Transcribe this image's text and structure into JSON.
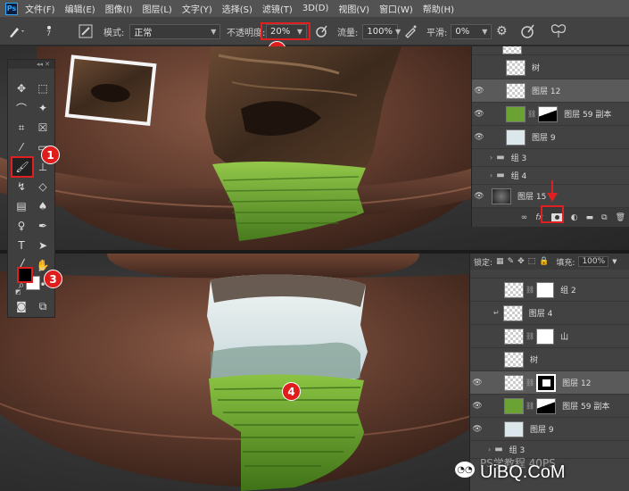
{
  "menu": {
    "logo": "Ps",
    "items": [
      "文件(F)",
      "编辑(E)",
      "图像(I)",
      "图层(L)",
      "文字(Y)",
      "选择(S)",
      "滤镜(T)",
      "3D(D)",
      "视图(V)",
      "窗口(W)",
      "帮助(H)"
    ]
  },
  "options": {
    "brush_size": "7",
    "mode_label": "模式:",
    "mode_value": "正常",
    "opacity_label": "不透明度:",
    "opacity_value": "20%",
    "flow_label": "流量:",
    "flow_value": "100%",
    "smooth_label": "平滑:",
    "smooth_value": "0%"
  },
  "top_layers": [
    {
      "name": "树",
      "visible": false
    },
    {
      "name": "图层 12",
      "visible": true,
      "selected": true
    },
    {
      "name": "图层 59 副本",
      "visible": true
    },
    {
      "name": "图层 9",
      "visible": true
    },
    {
      "name": "组 3",
      "visible": false,
      "group": true
    },
    {
      "name": "组 4",
      "visible": false,
      "group": true
    },
    {
      "name": "图层 15",
      "visible": true
    }
  ],
  "bottom_layers_header": {
    "lock_label": "锁定:",
    "fill_label": "填充:",
    "fill_value": "100%"
  },
  "bottom_layers": [
    {
      "name": "组 2",
      "visible": false
    },
    {
      "name": "图层 4",
      "visible": false
    },
    {
      "name": "山",
      "visible": false
    },
    {
      "name": "树",
      "visible": false
    },
    {
      "name": "图层 12",
      "visible": true,
      "selected": true
    },
    {
      "name": "图层 59 副本",
      "visible": true
    },
    {
      "name": "图层 9",
      "visible": true
    },
    {
      "name": "组 3",
      "visible": false,
      "group": true
    }
  ],
  "layer_footer_icons": [
    "link-icon",
    "fx-icon",
    "mask-icon",
    "adjustment-icon",
    "folder-icon",
    "new-layer-icon",
    "trash-icon"
  ],
  "badges": [
    "1",
    "2",
    "3",
    "4"
  ],
  "watermark": "UiBQ.CoM",
  "watermark_partial": "PS学教程 40PS",
  "colors": {
    "accent_red": "#e01d1d",
    "teapot": "#5e3a2c",
    "grass": "#6ba629",
    "sky": "#dbe7ea"
  }
}
